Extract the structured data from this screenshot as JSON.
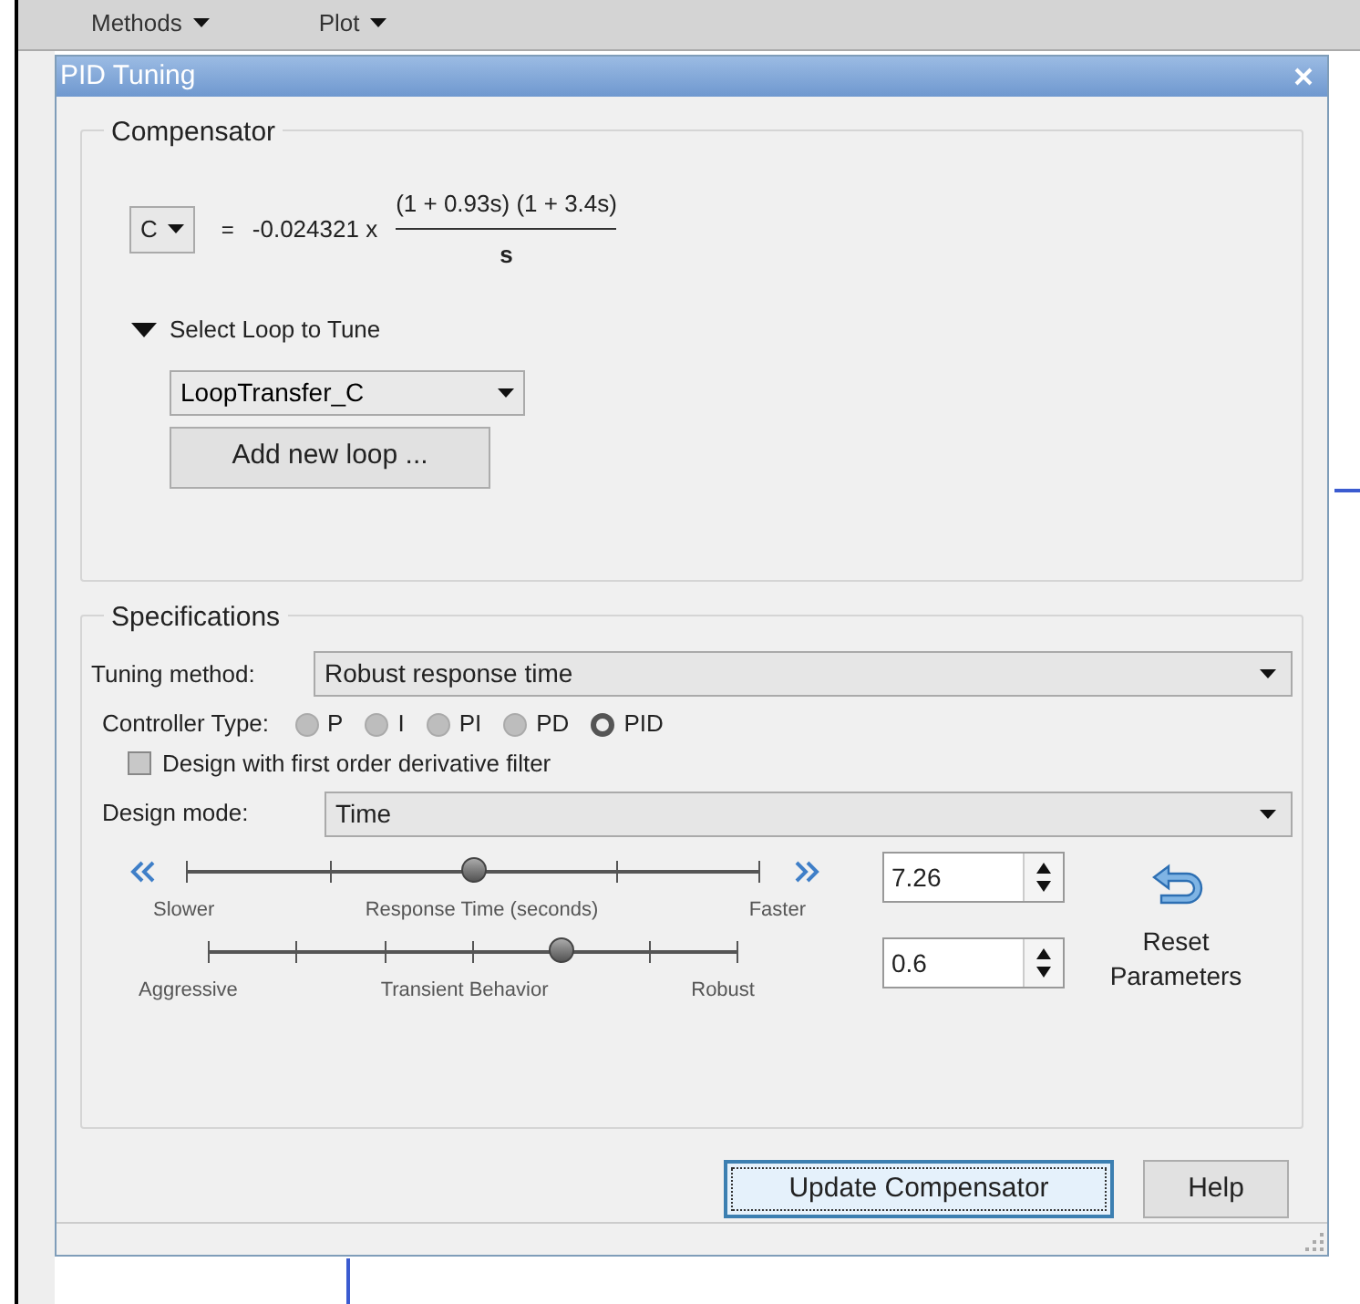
{
  "toolbar": {
    "menus": [
      {
        "label": "Methods"
      },
      {
        "label": "Plot"
      }
    ]
  },
  "dialog": {
    "title": "PID Tuning"
  },
  "compensator": {
    "title": "Compensator",
    "selector": "C",
    "equals": "=",
    "gain": "-0.024321 x",
    "numerator": "(1 + 0.93s) (1 + 3.4s)",
    "denominator": "s",
    "loop_section": {
      "label": "Select Loop to Tune",
      "expanded": true
    },
    "loop_dropdown": "LoopTransfer_C",
    "add_button": "Add new loop ..."
  },
  "specifications": {
    "title": "Specifications",
    "tuning_method": {
      "label": "Tuning method:",
      "value": "Robust response time"
    },
    "controller_type": {
      "label": "Controller Type:",
      "options": [
        {
          "label": "P",
          "selected": false
        },
        {
          "label": "I",
          "selected": false
        },
        {
          "label": "PI",
          "selected": false
        },
        {
          "label": "PD",
          "selected": false
        },
        {
          "label": "PID",
          "selected": true
        }
      ]
    },
    "derivative_filter": {
      "label": "Design with first order derivative filter",
      "checked": false
    },
    "design_mode": {
      "label": "Design mode:",
      "value": "Time"
    },
    "sliders": [
      {
        "kind": "response",
        "left": "Slower",
        "center": "Response Time (seconds)",
        "right": "Faster",
        "level": 0.5,
        "value": "7.26"
      },
      {
        "kind": "transient",
        "left": "Aggressive",
        "center": "Transient Behavior",
        "right": "Robust",
        "level": 0.667,
        "value": "0.6"
      }
    ],
    "reset": "Reset Parameters"
  },
  "buttons": [
    {
      "label": "Update Compensator",
      "focused": true
    },
    {
      "label": "Help",
      "focused": false
    }
  ]
}
